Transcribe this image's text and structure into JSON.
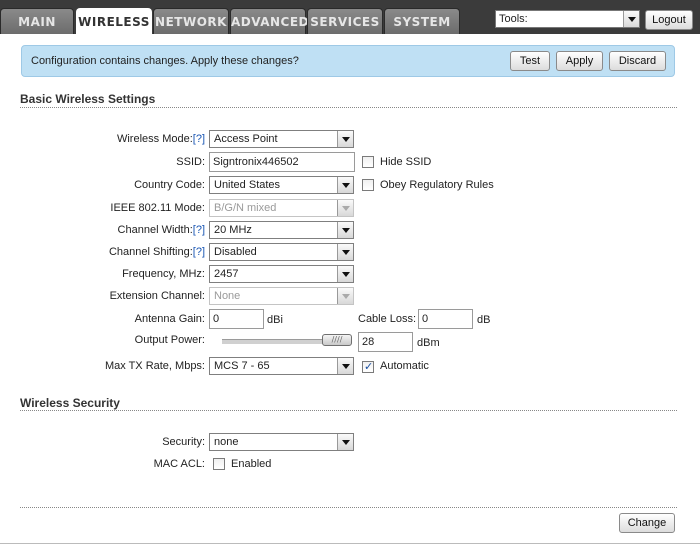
{
  "nav": {
    "tabs": [
      "MAIN",
      "WIRELESS",
      "NETWORK",
      "ADVANCED",
      "SERVICES",
      "SYSTEM"
    ],
    "active_tab": "WIRELESS",
    "tools_label": "Tools:",
    "logout_label": "Logout"
  },
  "banner": {
    "message": "Configuration contains changes. Apply these changes?",
    "test_label": "Test",
    "apply_label": "Apply",
    "discard_label": "Discard"
  },
  "basic": {
    "title": "Basic Wireless Settings",
    "help_mark": "[?]",
    "wireless_mode": {
      "label": "Wireless Mode:",
      "value": "Access Point"
    },
    "ssid": {
      "label": "SSID:",
      "value": "Signtronix446502",
      "hide_label": "Hide SSID",
      "hide_checked": false
    },
    "country": {
      "label": "Country Code:",
      "value": "United States",
      "obey_label": "Obey Regulatory Rules",
      "obey_checked": false
    },
    "ieee_mode": {
      "label": "IEEE 802.11 Mode:",
      "value": "B/G/N mixed"
    },
    "channel_width": {
      "label": "Channel Width:",
      "value": "20 MHz"
    },
    "channel_shifting": {
      "label": "Channel Shifting:",
      "value": "Disabled"
    },
    "frequency": {
      "label": "Frequency, MHz:",
      "value": "2457"
    },
    "extension_channel": {
      "label": "Extension Channel:",
      "value": "None"
    },
    "antenna_gain": {
      "label": "Antenna Gain:",
      "value": "0",
      "unit": "dBi"
    },
    "cable_loss": {
      "label": "Cable Loss:",
      "value": "0",
      "unit": "dB"
    },
    "output_power": {
      "label": "Output Power:",
      "value": "28",
      "unit": "dBm",
      "slider_fraction": 1.0
    },
    "max_tx": {
      "label": "Max TX Rate, Mbps:",
      "value": "MCS 7 - 65",
      "auto_label": "Automatic",
      "auto_checked": true
    }
  },
  "security": {
    "title": "Wireless Security",
    "security": {
      "label": "Security:",
      "value": "none"
    },
    "mac_acl": {
      "label": "MAC ACL:",
      "enabled_label": "Enabled",
      "enabled_checked": false
    }
  },
  "footer": {
    "change_label": "Change"
  }
}
